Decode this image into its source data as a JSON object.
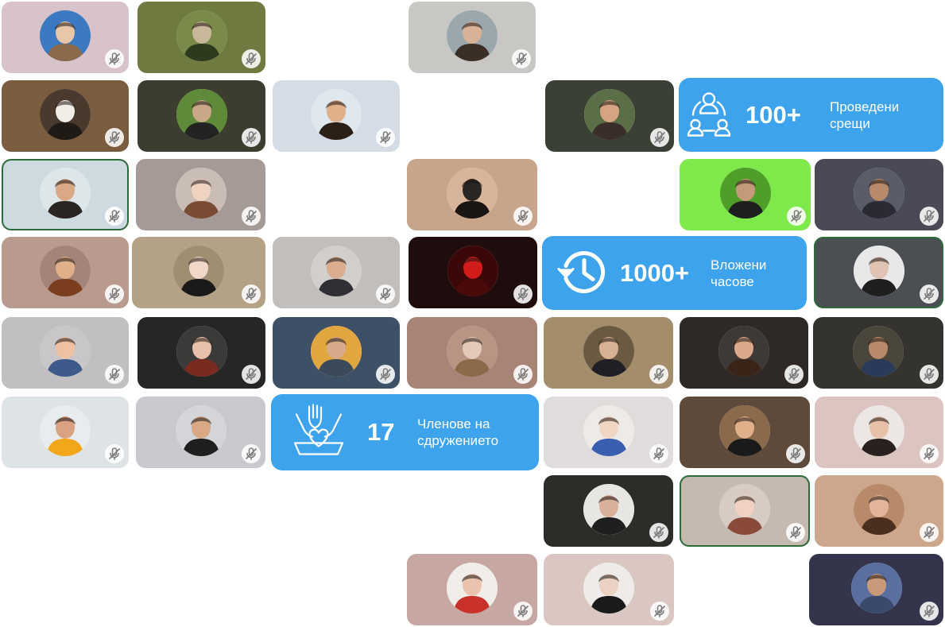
{
  "colors": {
    "stat_background": "#3da3ec",
    "stat_text": "#ffffff",
    "mute_badge": "#ffffff",
    "active_speaker_border": "#2f6b3a"
  },
  "icons": {
    "participant_mute": "microphone-off-icon",
    "meetings": "people-network-icon",
    "hours": "clock-history-icon",
    "members": "raised-hands-heart-icon"
  },
  "stats": {
    "meetings": {
      "number": "100+",
      "label_line1": "Проведени",
      "label_line2": "срещи"
    },
    "hours": {
      "number": "1000+",
      "label_line1": "Вложени",
      "label_line2": "часове"
    },
    "members": {
      "number": "17",
      "label_line1": "Членове на",
      "label_line2": "сдружението"
    }
  },
  "participants_muted": true
}
